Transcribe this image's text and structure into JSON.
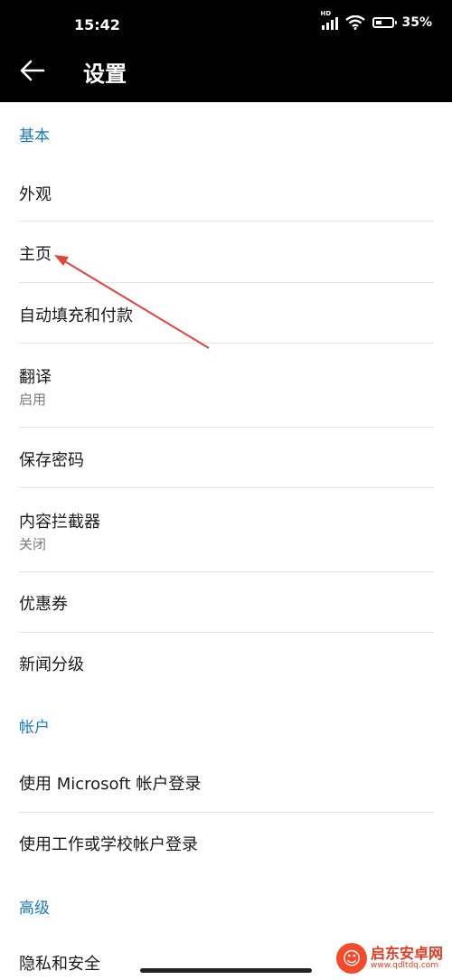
{
  "status": {
    "time": "15:42",
    "hd": "HD",
    "battery": "35%",
    "battery_level": 0.35
  },
  "header": {
    "title": "设置"
  },
  "sections": {
    "basic": "基本",
    "account": "帐户",
    "advanced": "高级"
  },
  "items": {
    "appearance": "外观",
    "homepage": "主页",
    "autofill": "自动填充和付款",
    "translate": "翻译",
    "translate_sub": "启用",
    "passwords": "保存密码",
    "blocker": "内容拦截器",
    "blocker_sub": "关闭",
    "coupons": "优惠券",
    "news": "新闻分级",
    "ms_login": "使用 Microsoft 帐户登录",
    "work_login": "使用工作或学校帐户登录",
    "privacy": "隐私和安全"
  },
  "watermark": {
    "title": "启东安卓网",
    "url": "www.qdltdq.com"
  },
  "colors": {
    "accent": "#1a78c2",
    "annotation": "#e0453a"
  }
}
